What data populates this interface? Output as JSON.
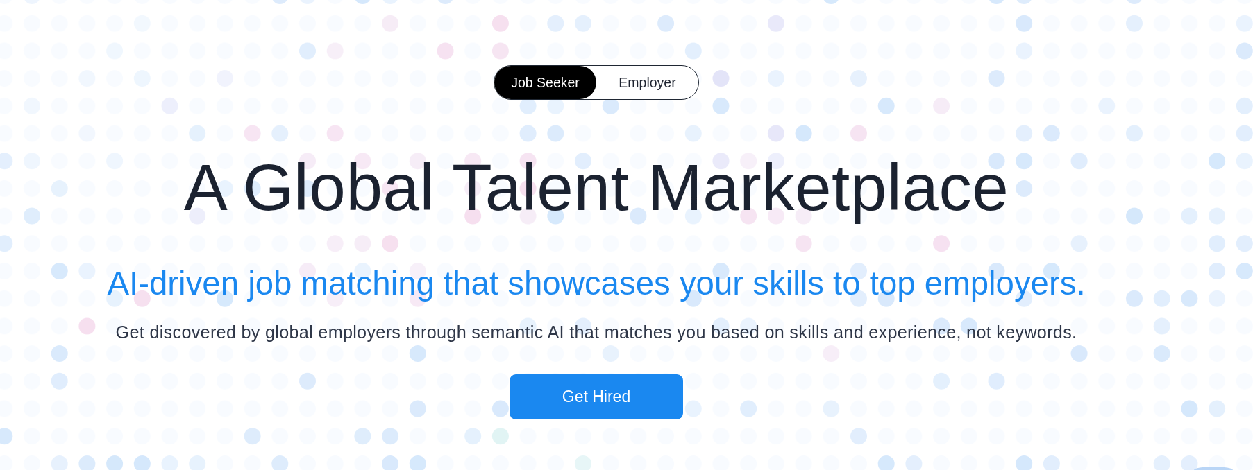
{
  "toggle": [
    {
      "label": "Job Seeker",
      "selected": true
    },
    {
      "label": "Employer",
      "selected": false
    }
  ],
  "hero": {
    "title": "A Global Talent Marketplace",
    "subtitle": "AI-driven job matching that showcases your skills to top employers.",
    "description": "Get discovered by global employers through semantic AI that matches you based on skills and experience, not keywords.",
    "cta": "Get Hired"
  }
}
